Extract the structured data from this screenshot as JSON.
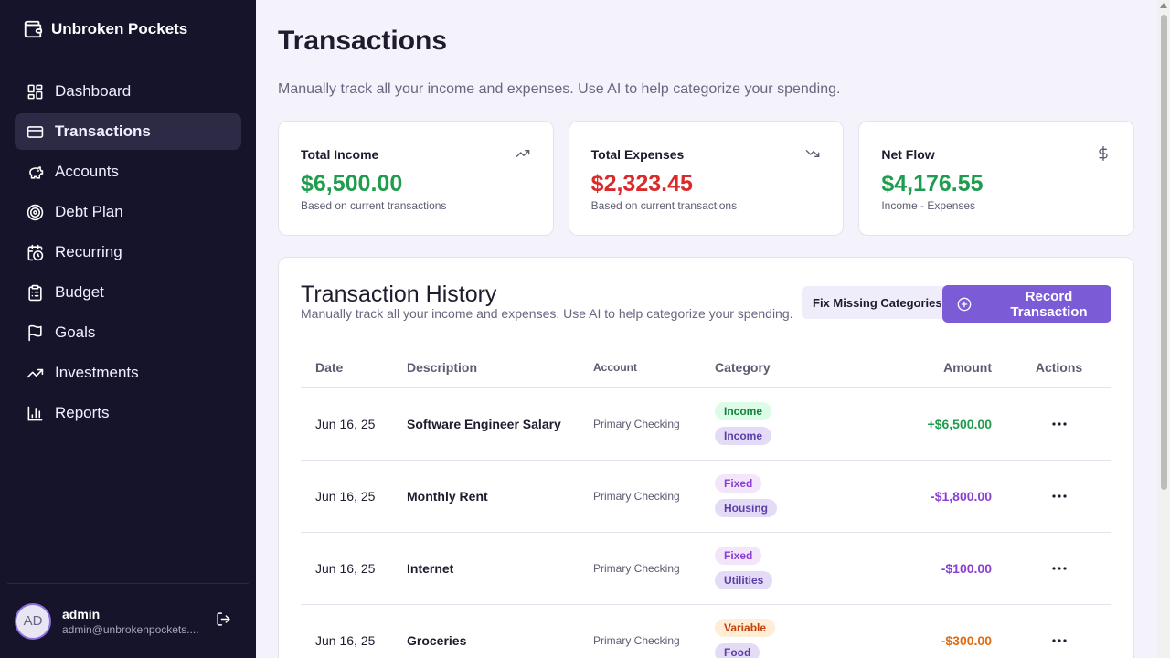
{
  "brand": {
    "name": "Unbroken Pockets",
    "icon": "wallet-icon"
  },
  "nav": [
    {
      "label": "Dashboard",
      "icon": "dashboard-icon",
      "active": false
    },
    {
      "label": "Transactions",
      "icon": "card-icon",
      "active": true
    },
    {
      "label": "Accounts",
      "icon": "piggy-bank-icon",
      "active": false
    },
    {
      "label": "Debt Plan",
      "icon": "target-icon",
      "active": false
    },
    {
      "label": "Recurring",
      "icon": "calendar-clock-icon",
      "active": false
    },
    {
      "label": "Budget",
      "icon": "clipboard-icon",
      "active": false
    },
    {
      "label": "Goals",
      "icon": "flag-icon",
      "active": false
    },
    {
      "label": "Investments",
      "icon": "trending-up-icon",
      "active": false
    },
    {
      "label": "Reports",
      "icon": "bar-chart-icon",
      "active": false
    }
  ],
  "user": {
    "initials": "AD",
    "name": "admin",
    "email": "admin@unbrokenpockets...."
  },
  "page": {
    "title": "Transactions",
    "subtitle": "Manually track all your income and expenses. Use AI to help categorize your spending."
  },
  "cards": [
    {
      "label": "Total Income",
      "value": "$6,500.00",
      "note": "Based on current transactions",
      "tone": "green",
      "icon": "trending-up-icon"
    },
    {
      "label": "Total Expenses",
      "value": "$2,323.45",
      "note": "Based on current transactions",
      "tone": "red",
      "icon": "trending-down-icon"
    },
    {
      "label": "Net Flow",
      "value": "$4,176.55",
      "note": "Income - Expenses",
      "tone": "green",
      "icon": "dollar-icon"
    }
  ],
  "history": {
    "title": "Transaction History",
    "subtitle": "Manually track all your income and expenses. Use AI to help categorize your spending.",
    "fix_label": "Fix Missing Categories",
    "record_label": "Record Transaction",
    "columns": [
      "Date",
      "Description",
      "Account",
      "Category",
      "Amount",
      "Actions"
    ],
    "rows": [
      {
        "date": "Jun 16, 25",
        "description": "Software Engineer Salary",
        "account": "Primary Checking",
        "type": "Income",
        "category": "Income",
        "amount": "+$6,500.00",
        "amount_tone": "pos"
      },
      {
        "date": "Jun 16, 25",
        "description": "Monthly Rent",
        "account": "Primary Checking",
        "type": "Fixed",
        "category": "Housing",
        "amount": "-$1,800.00",
        "amount_tone": "neg"
      },
      {
        "date": "Jun 16, 25",
        "description": "Internet",
        "account": "Primary Checking",
        "type": "Fixed",
        "category": "Utilities",
        "amount": "-$100.00",
        "amount_tone": "neg"
      },
      {
        "date": "Jun 16, 25",
        "description": "Groceries",
        "account": "Primary Checking",
        "type": "Variable",
        "category": "Food",
        "amount": "-$300.00",
        "amount_tone": "var"
      }
    ]
  },
  "colors": {
    "sidebar_bg": "#16142b",
    "accent": "#7c5cd6",
    "positive": "#1f9d4e",
    "negative": "#d92b2b",
    "fixed_amount": "#8a3fd1",
    "variable_amount": "#e06b10"
  }
}
